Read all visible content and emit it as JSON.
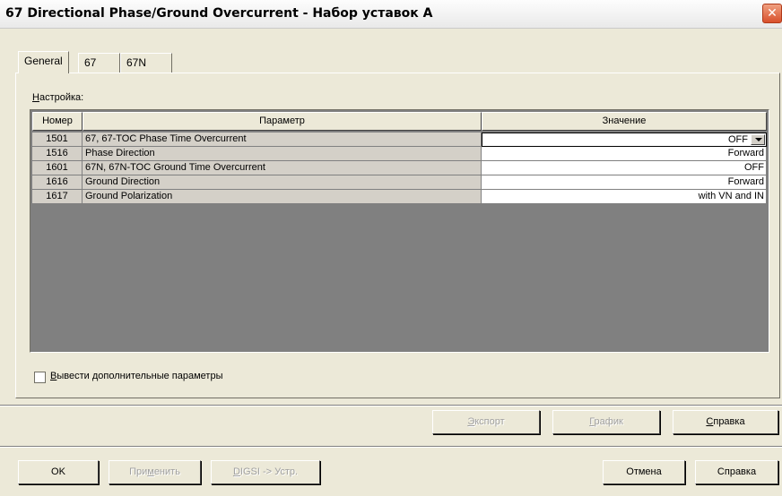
{
  "window": {
    "title": "67 Directional Phase/Ground Overcurrent - Набор уставок A",
    "close_glyph": "✕"
  },
  "tabs": [
    {
      "label": "General"
    },
    {
      "label": "67"
    },
    {
      "label": "67N"
    }
  ],
  "section": {
    "label_first": "Н",
    "label_rest": "астройка:"
  },
  "grid": {
    "headers": {
      "num": "Номер",
      "param": "Параметр",
      "value": "Значение"
    },
    "rows": [
      {
        "num": "1501",
        "param": "67, 67-TOC Phase Time Overcurrent",
        "value": "OFF"
      },
      {
        "num": "1516",
        "param": "Phase Direction",
        "value": "Forward"
      },
      {
        "num": "1601",
        "param": "67N, 67N-TOC Ground Time Overcurrent",
        "value": "OFF"
      },
      {
        "num": "1616",
        "param": "Ground Direction",
        "value": "Forward"
      },
      {
        "num": "1617",
        "param": "Ground Polarization",
        "value": "with VN and IN"
      }
    ]
  },
  "checkbox": {
    "label_first": "В",
    "label_rest": "ывести дополнительные параметры",
    "checked": false
  },
  "panel_buttons": {
    "export": {
      "first": "Э",
      "rest": "кспорт"
    },
    "graph": {
      "first": "Г",
      "rest": "рафик"
    },
    "help": {
      "first": "С",
      "rest": "правка"
    }
  },
  "footer_buttons": {
    "ok": "OK",
    "apply": {
      "pre": "При",
      "u": "м",
      "post": "енить"
    },
    "digsi": {
      "u": "D",
      "post": "IGSI -> Устр."
    },
    "cancel": "Отмена",
    "help": "Справка"
  }
}
